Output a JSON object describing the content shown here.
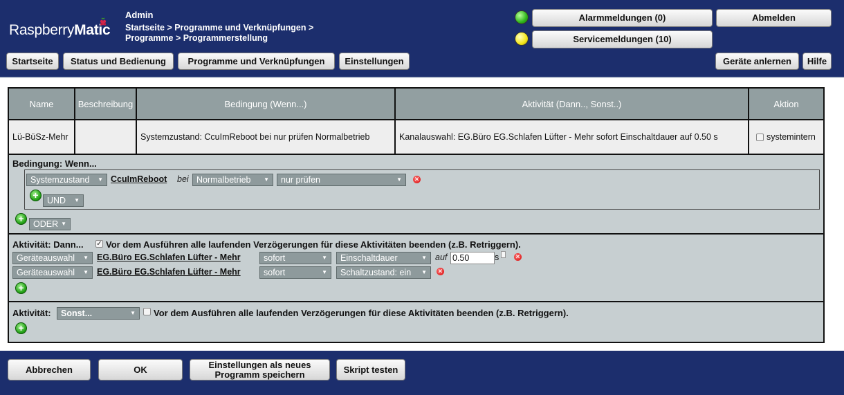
{
  "header": {
    "logo_light": "Raspberry",
    "logo_bold": "Matic",
    "user": "Admin",
    "breadcrumb_line1": "Startseite > Programme und Verknüpfungen >",
    "breadcrumb_line2": "Programme > Programmerstellung",
    "alarm_button": "Alarmmeldungen (0)",
    "service_button": "Servicemeldungen (10)",
    "logout_button": "Abmelden",
    "led_colors": {
      "alarm": "#2fb51a",
      "service": "#f3e51a"
    }
  },
  "nav": {
    "home": "Startseite",
    "status": "Status und Bedienung",
    "programs": "Programme und Verknüpfungen",
    "settings": "Einstellungen",
    "teach_devices": "Geräte anlernen",
    "help": "Hilfe"
  },
  "table": {
    "headers": {
      "name": "Name",
      "description": "Beschreibung",
      "condition": "Bedingung (Wenn...)",
      "activity": "Aktivität (Dann.., Sonst..)",
      "action": "Aktion"
    },
    "row": {
      "name": "Lü-BüSz-Mehr",
      "description": "",
      "condition": "Systemzustand: CcuImReboot bei nur prüfen Normalbetrieb",
      "activity": "Kanalauswahl: EG.Büro EG.Schlafen Lüfter - Mehr sofort Einschaltdauer auf 0.50 s",
      "action_checkbox_label": "systemintern"
    }
  },
  "condition_section": {
    "title": "Bedingung: Wenn...",
    "type_select": "Systemzustand",
    "object_link": "CcuImReboot",
    "bei_text": "bei",
    "value_select": "Normalbetrieb",
    "trigger_select": "nur prüfen",
    "and_select": "UND",
    "or_select": "ODER"
  },
  "activity_section": {
    "title": "Aktivität: Dann...",
    "stop_delays_label": "Vor dem Ausführen alle laufenden Verzögerungen für diese Aktivitäten beenden (z.B. Retriggern).",
    "row1": {
      "type_select": "Geräteauswahl",
      "device_link": "EG.Büro EG.Schlafen Lüfter - Mehr",
      "timing_select": "sofort",
      "param_select": "Einschaltdauer",
      "auf_text": "auf",
      "value_input": "0.50",
      "unit": "s"
    },
    "row2": {
      "type_select": "Geräteauswahl",
      "device_link": "EG.Büro EG.Schlafen Lüfter - Mehr",
      "timing_select": "sofort",
      "param_select": "Schaltzustand: ein"
    }
  },
  "else_section": {
    "title": "Aktivität:",
    "else_select": "Sonst...",
    "stop_delays_label": "Vor dem Ausführen alle laufenden Verzögerungen für diese Aktivitäten beenden (z.B. Retriggern)."
  },
  "footer": {
    "cancel": "Abbrechen",
    "ok": "OK",
    "save_as_new_line1": "Einstellungen als neues",
    "save_as_new_line2": "Programm speichern",
    "test_script": "Skript testen"
  }
}
